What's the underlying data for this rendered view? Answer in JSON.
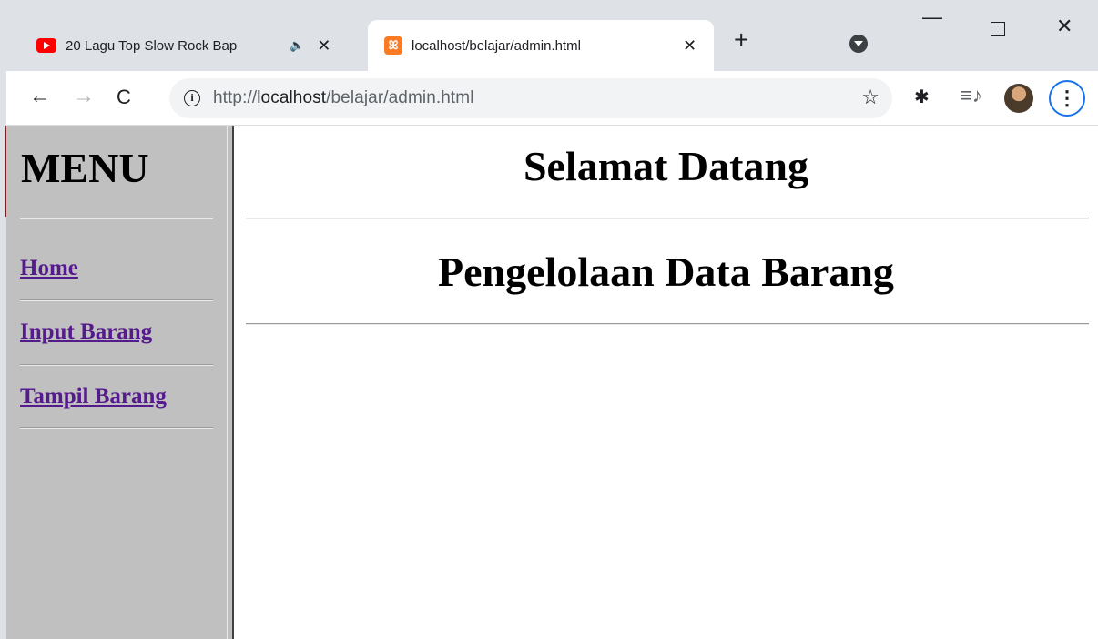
{
  "browser": {
    "tabs": [
      {
        "title": "20 Lagu Top Slow Rock Bap",
        "audio": "🔈",
        "close": "✕"
      },
      {
        "title": "localhost/belajar/admin.html",
        "favicon": "ꕤ",
        "close": "✕"
      }
    ],
    "new_tab": "+",
    "window": {
      "minimize": "—",
      "close": "✕"
    },
    "nav": {
      "back": "←",
      "forward": "→",
      "reload": "C"
    },
    "url_prefix": "http://",
    "url_host": "localhost",
    "url_path": "/belajar/admin.html",
    "info": "i",
    "star": "☆",
    "extensions": "✱",
    "media": "≡♪",
    "menu": "⋮"
  },
  "sidebar": {
    "title": "MENU",
    "links": [
      {
        "label": "Home"
      },
      {
        "label": "Input Barang"
      },
      {
        "label": "Tampil Barang"
      }
    ]
  },
  "main": {
    "heading1": "Selamat Datang",
    "heading2": "Pengelolaan Data Barang"
  },
  "colors": {
    "sidebar_bg": "#c0c0c0",
    "link_visited": "#551a8b",
    "chrome_bg": "#dee1e6"
  }
}
